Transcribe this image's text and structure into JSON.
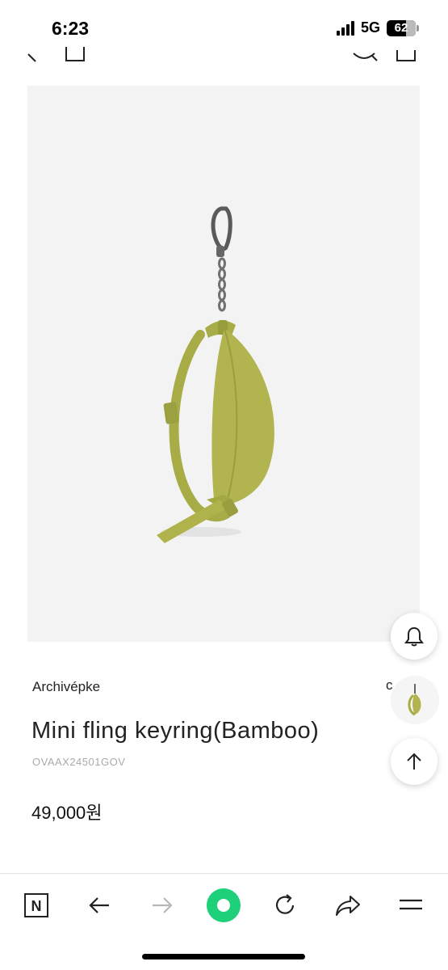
{
  "status_bar": {
    "time": "6:23",
    "network": "5G",
    "battery": "62"
  },
  "header": {
    "icons": [
      "back-icon",
      "bag-icon",
      "search-icon",
      "cart-icon"
    ]
  },
  "product": {
    "image_icon": "keyring-product-image",
    "brand": "Archivépke",
    "brand_partial": "c",
    "name": "Mini fling keyring(Bamboo)",
    "code": "OVAAX24501GOV",
    "price": "49,000원"
  },
  "floating": {
    "icons": [
      "bell-icon",
      "thumbnail",
      "arrow-up-icon"
    ]
  },
  "browser_bar": {
    "n_label": "N",
    "icons": [
      "naver-n-icon",
      "back-arrow-icon",
      "forward-arrow-icon",
      "green-dot-icon",
      "refresh-icon",
      "share-icon",
      "menu-icon"
    ],
    "colors": {
      "accent": "#1fd07a",
      "disabled": "#b8b8b8"
    }
  }
}
